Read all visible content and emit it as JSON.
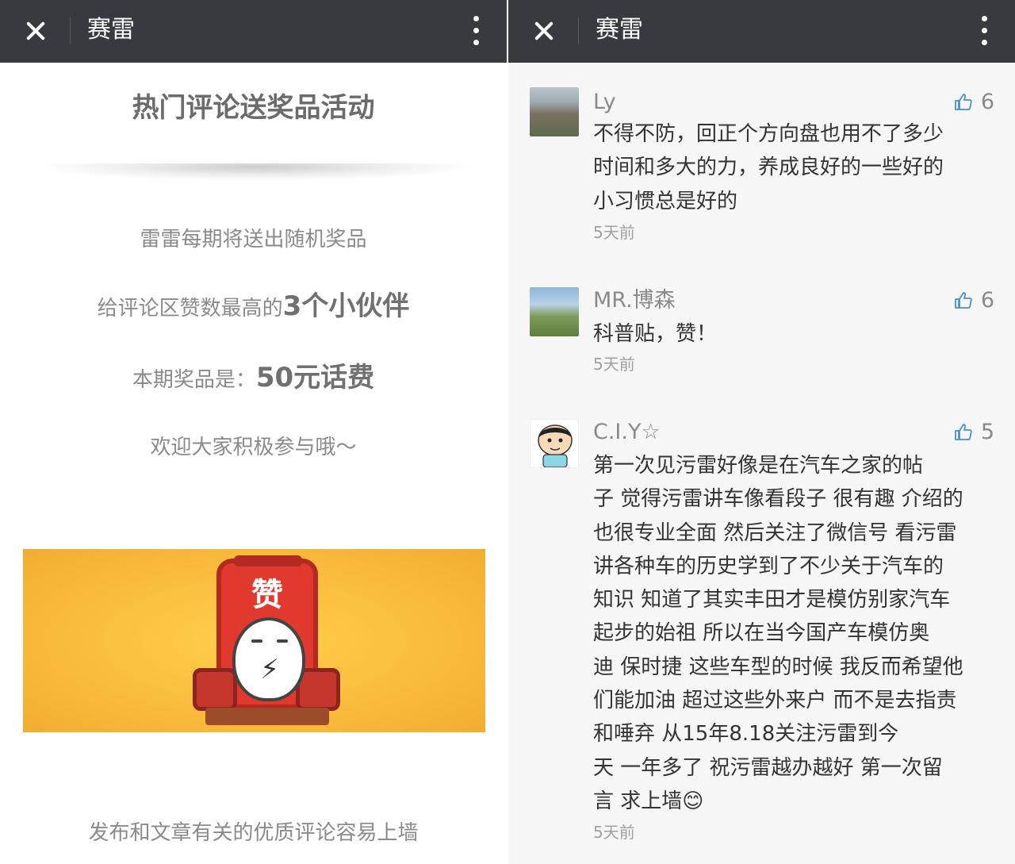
{
  "left": {
    "topbar": {
      "title": "赛雷"
    },
    "article": {
      "heading": "热门评论送奖品活动",
      "para1": "雷雷每期将送出随机奖品",
      "para2_prefix": "给评论区赞数最高的",
      "para2_highlight": "3个小伙伴",
      "para3_prefix": "本期奖品是：",
      "para3_highlight": "50元话费",
      "para4": "欢迎大家积极参与哦～",
      "banner_text": "赞",
      "footer": "发布和文章有关的优质评论容易上墙"
    }
  },
  "right": {
    "topbar": {
      "title": "赛雷"
    },
    "comments": [
      {
        "author": "Ly",
        "likes": "6",
        "lines": [
          "不得不防，回正个方向盘也用不了多少",
          "时间和多大的力，养成良好的一些好的",
          "小习惯总是好的"
        ],
        "time": "5天前"
      },
      {
        "author": "MR.博森",
        "likes": "6",
        "lines": [
          "科普贴，赞！"
        ],
        "time": "5天前"
      },
      {
        "author": "C.I.Y☆",
        "likes": "5",
        "lines": [
          "第一次见污雷好像是在汽车之家的帖",
          "子 觉得污雷讲车像看段子 很有趣 介绍的",
          "也很专业全面  然后关注了微信号 看污雷",
          "讲各种车的历史学到了不少关于汽车的",
          "知识  知道了其实丰田才是模仿别家汽车",
          "起步的始祖  所以在当今国产车模仿奥",
          "迪 保时捷 这些车型的时候 我反而希望他",
          "们能加油 超过这些外来户 而不是去指责",
          "和唾弃    从15年8.18关注污雷到今",
          "天  一年多了 祝污雷越办越好 第一次留",
          "言 求上墙😊"
        ],
        "time": "5天前"
      }
    ]
  }
}
